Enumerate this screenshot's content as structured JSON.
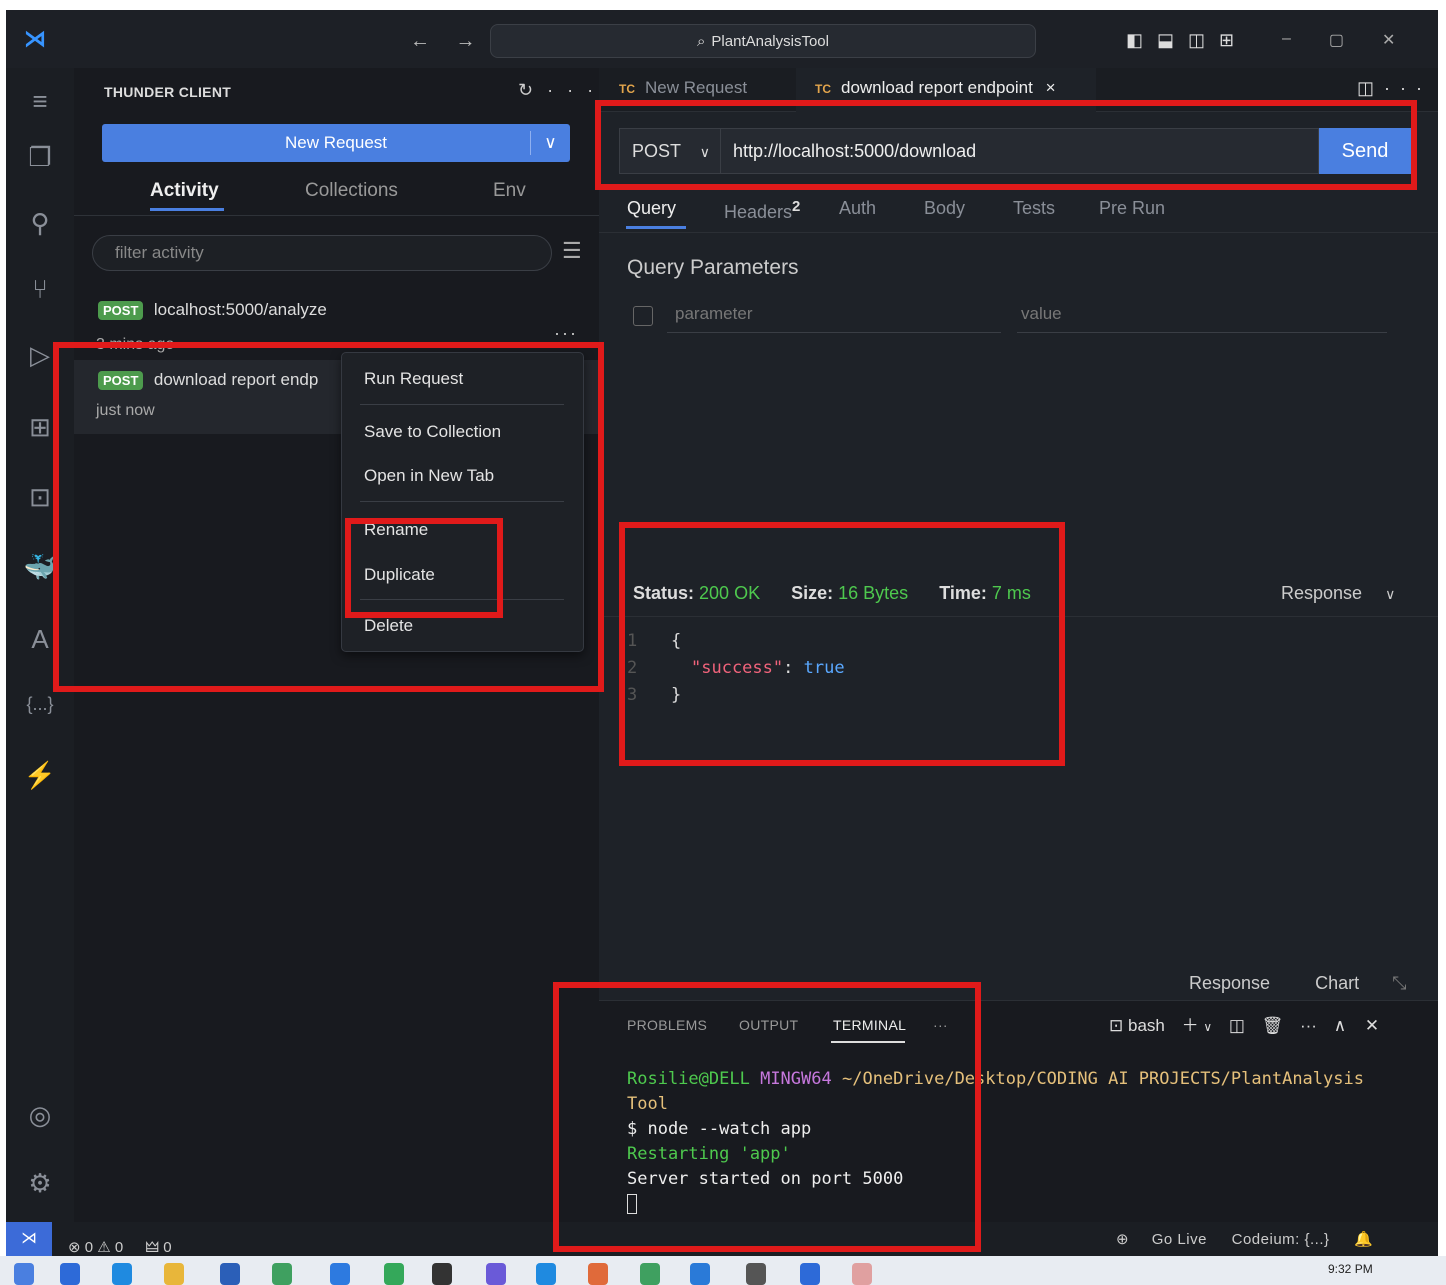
{
  "window": {
    "title": "PlantAnalysisTool",
    "nav": "← →"
  },
  "sidebar": {
    "title": "THUNDER CLIENT",
    "new_request": "New Request",
    "tabs": [
      "Activity",
      "Collections",
      "Env"
    ],
    "filter_placeholder": "filter activity",
    "activities": [
      {
        "method": "POST",
        "name": "localhost:5000/analyze",
        "time": "3 mins ago"
      },
      {
        "method": "POST",
        "name": "download report endp",
        "time": "just now"
      }
    ]
  },
  "context_menu": [
    "Run Request",
    "Save to Collection",
    "Open in New Tab",
    "Rename",
    "Duplicate",
    "Delete"
  ],
  "editor": {
    "tabs": [
      {
        "prefix": "TC",
        "label": "New Request"
      },
      {
        "prefix": "TC",
        "label": "download report endpoint",
        "close": "×"
      }
    ],
    "method": "POST",
    "url": "http://localhost:5000/download",
    "send": "Send",
    "request_tabs": [
      {
        "label": "Query",
        "sup": ""
      },
      {
        "label": "Headers",
        "sup": "2"
      },
      {
        "label": "Auth",
        "sup": ""
      },
      {
        "label": "Body",
        "sup": ""
      },
      {
        "label": "Tests",
        "sup": ""
      },
      {
        "label": "Pre Run",
        "sup": ""
      }
    ],
    "query_title": "Query Parameters",
    "param_placeholder": "parameter",
    "value_placeholder": "value"
  },
  "response": {
    "status_label": "Status:",
    "status": "200 OK",
    "size_label": "Size:",
    "size": "16 Bytes",
    "time_label": "Time:",
    "time": "7 ms",
    "view": "Response",
    "lines": [
      "1",
      "2",
      "3"
    ],
    "open": "{",
    "key": "\"success\"",
    "colon": ": ",
    "value": "true",
    "close": "}",
    "bottom_tabs": [
      "Response",
      "Chart"
    ]
  },
  "panel": {
    "tabs": [
      "PROBLEMS",
      "OUTPUT",
      "TERMINAL",
      "···"
    ],
    "shell": "bash",
    "terminal": {
      "user": "Rosilie@DELL",
      "env": "MINGW64",
      "path": "~/OneDrive/Desktop/CODING AI PROJECTS/PlantAnalysis",
      "path2": "Tool",
      "cmd": "$ node --watch app",
      "restart": "Restarting 'app'",
      "server": "Server started on port 5000"
    }
  },
  "statusbar": {
    "problems": "⊗ 0 ⚠ 0",
    "ports": "🜲 0",
    "golive": "Go Live",
    "codeium": "Codeium: {...}"
  },
  "taskbar": {
    "clock": "9:32 PM"
  },
  "colors": {
    "accent": "#4a7fe0",
    "post_badge": "#4d9b4d",
    "success": "#4ec94e",
    "highlight": "#e01a1a"
  }
}
